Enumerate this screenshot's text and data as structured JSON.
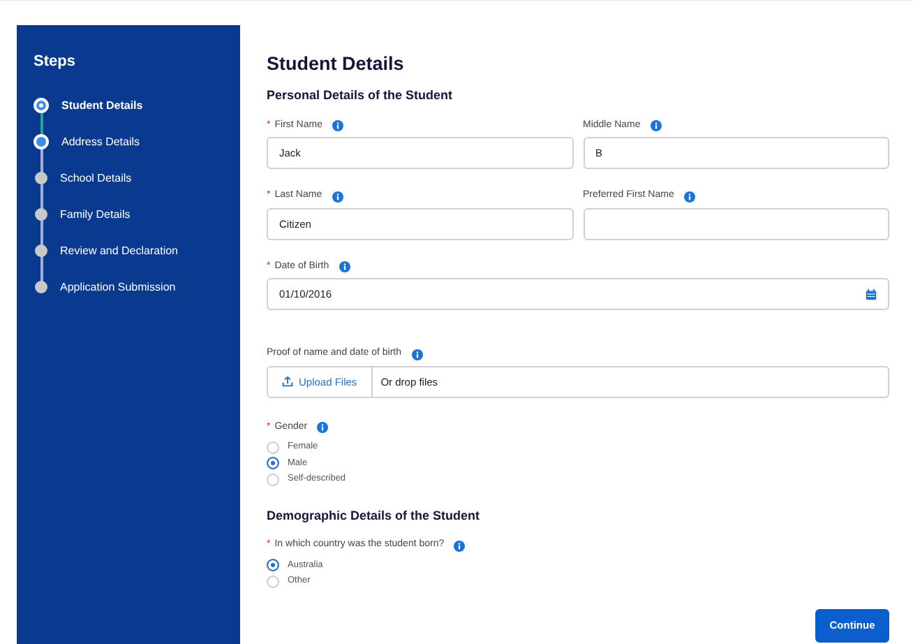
{
  "sidebar": {
    "title": "Steps",
    "steps": [
      {
        "label": "Student Details",
        "selected": true,
        "reached": true
      },
      {
        "label": "Address Details",
        "selected": false,
        "reached": true
      },
      {
        "label": "School Details",
        "selected": false,
        "reached": false
      },
      {
        "label": "Family Details",
        "selected": false,
        "reached": false
      },
      {
        "label": "Review and Declaration",
        "selected": false,
        "reached": false
      },
      {
        "label": "Application Submission",
        "selected": false,
        "reached": false
      }
    ]
  },
  "page_title": "Student Details",
  "form": [
    {
      "kind": "heading",
      "text": "Personal Details of the Student"
    },
    {
      "kind": "row",
      "fields": [
        {
          "required_mark": "*",
          "label": "First Name",
          "value": "Jack"
        },
        {
          "label": "Middle Name",
          "value": "B"
        }
      ]
    },
    {
      "kind": "row",
      "fields": [
        {
          "required_mark": "*",
          "label": "Last Name",
          "value": "Citizen"
        },
        {
          "label": "Preferred First Name"
        }
      ]
    },
    {
      "kind": "date",
      "required_mark": "*",
      "label": "Date of Birth",
      "value": "01/10/2016"
    },
    {
      "kind": "file",
      "label": "Proof of name and date of birth",
      "button": "Upload Files",
      "hint": "Or drop files"
    },
    {
      "kind": "radio",
      "required_mark": "*",
      "label": "Gender",
      "options": [
        {
          "label": "Female",
          "selected": false
        },
        {
          "label": "Male",
          "selected": true
        },
        {
          "label": "Self-described",
          "selected": false
        }
      ]
    },
    {
      "kind": "heading",
      "text": "Demographic Details of the Student"
    },
    {
      "kind": "radio",
      "required_mark": "*",
      "label": "In which country was the student born?",
      "options": [
        {
          "label": "Australia",
          "selected": true
        },
        {
          "label": "Other",
          "selected": false
        }
      ]
    }
  ],
  "continue_button": "Continue"
}
